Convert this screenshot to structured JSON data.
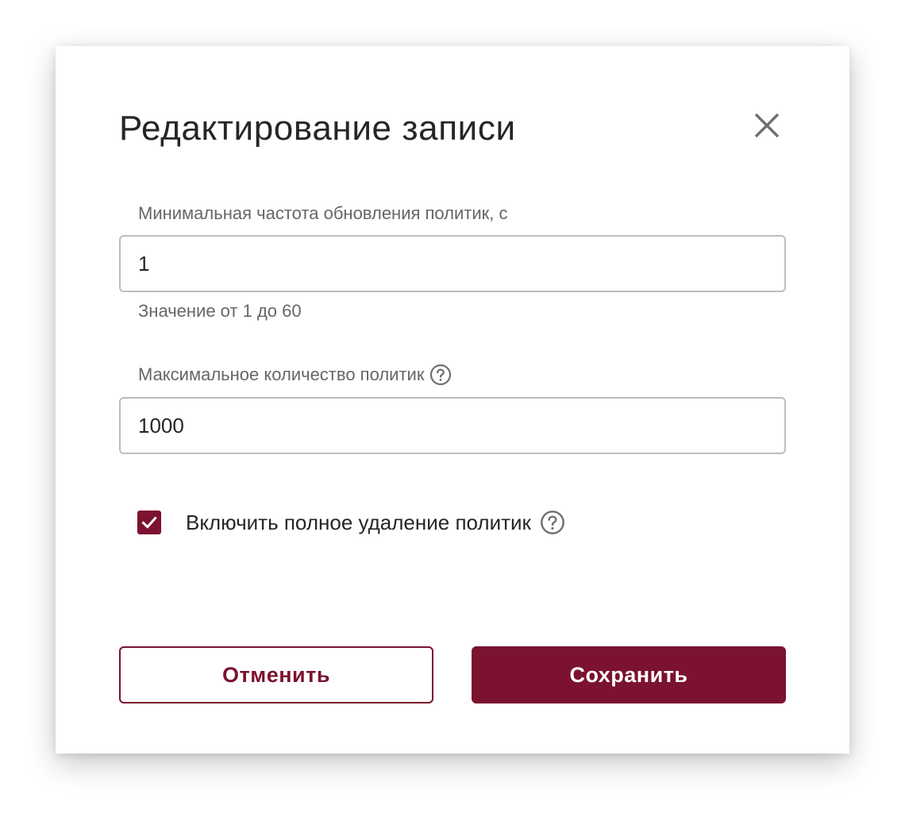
{
  "dialog": {
    "title": "Редактирование записи",
    "close_icon": "close-icon"
  },
  "fields": {
    "min_refresh": {
      "label": "Минимальная частота обновления политик, с",
      "value": "1",
      "hint": "Значение от 1 до 60"
    },
    "max_policies": {
      "label": "Максимальное количество политик",
      "value": "1000",
      "help_icon": "help-circle-icon"
    }
  },
  "checkbox": {
    "label": "Включить полное удаление политик",
    "checked": true,
    "help_icon": "help-circle-icon"
  },
  "buttons": {
    "cancel_label": "Отменить",
    "save_label": "Сохранить"
  },
  "colors": {
    "accent": "#7b122f",
    "text": "#262626",
    "muted_text": "#666666",
    "border": "#bdbdbd"
  }
}
